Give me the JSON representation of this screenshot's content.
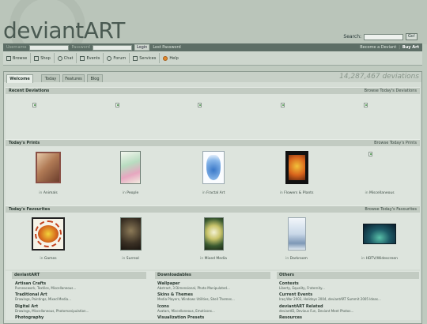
{
  "header": {
    "logo": "deviantART",
    "search_label": "Search:",
    "search_value": "",
    "search_button": "Go!"
  },
  "loginbar": {
    "username_label": "Username",
    "password_label": "Password",
    "login_button": "Login",
    "lost_password": "Lost Password",
    "become_deviant": "Become a Deviant",
    "separator": "|",
    "buy_art": "Buy Art"
  },
  "nav": {
    "items": [
      {
        "label": "Browse",
        "icon": "browse-icon"
      },
      {
        "label": "Shop",
        "icon": "printer-icon"
      },
      {
        "label": "Chat",
        "icon": "chat-icon"
      },
      {
        "label": "Events",
        "icon": "events-icon"
      },
      {
        "label": "Forum",
        "icon": "forum-icon"
      },
      {
        "label": "Services",
        "icon": "services-icon"
      },
      {
        "label": "Help",
        "icon": "help-icon"
      }
    ]
  },
  "tabs": [
    {
      "label": "Welcome",
      "active": true
    },
    {
      "label": "Today",
      "active": false
    },
    {
      "label": "Features",
      "active": false
    },
    {
      "label": "Blog",
      "active": false
    }
  ],
  "deviation_count": "14,287,467 deviations",
  "sections": {
    "recent": {
      "title": "Recent Deviations",
      "link": "Browse Today's Deviations"
    },
    "prints": {
      "title": "Today's Prints",
      "link": "Browse Today's Prints",
      "items": [
        {
          "prefix": "in",
          "category": "Animals"
        },
        {
          "prefix": "in",
          "category": "People"
        },
        {
          "prefix": "in",
          "category": "Fractal Art"
        },
        {
          "prefix": "in",
          "category": "Flowers & Plants"
        },
        {
          "prefix": "in",
          "category": "Miscellaneous"
        }
      ]
    },
    "favourites": {
      "title": "Today's Favourites",
      "link": "Browse Today's Favourites",
      "items": [
        {
          "prefix": "in",
          "category": "Games"
        },
        {
          "prefix": "in",
          "category": "Surreal"
        },
        {
          "prefix": "in",
          "category": "Mixed Media"
        },
        {
          "prefix": "in",
          "category": "Darkroom"
        },
        {
          "prefix": "in",
          "category": "HDTV/Widescreen"
        }
      ]
    }
  },
  "footer": {
    "col1": {
      "title": "deviantART",
      "entries": [
        {
          "name": "Artisan Crafts",
          "sub": "Purseacwork, Textiles, Miscellaneous..."
        },
        {
          "name": "Traditional Art",
          "sub": "Drawings, Paintings, Mixed Media..."
        },
        {
          "name": "Digital Art",
          "sub": "Drawings, Miscellaneous, Photomanipulation..."
        },
        {
          "name": "Photography",
          "sub": ""
        }
      ]
    },
    "col2": {
      "title": "Downloadables",
      "entries": [
        {
          "name": "Wallpaper",
          "sub": "Abstract, 3 Dimensional, Photo Manipulated..."
        },
        {
          "name": "Skins & Themes",
          "sub": "Media Players, Windows Utilities, Shell Themes..."
        },
        {
          "name": "Icons",
          "sub": "Avatars, Miscellaneous, Emoticons..."
        },
        {
          "name": "Visualization Presets",
          "sub": ""
        }
      ]
    },
    "col3": {
      "title": "Others",
      "entries": [
        {
          "name": "Contests",
          "sub": "Liberty, Equality, Fraternity..."
        },
        {
          "name": "Current Events",
          "sub": "Iraq War 2003, Holidays 2004, deviantART Summit 2005 Ideas..."
        },
        {
          "name": "deviantART Related",
          "sub": "deviantID, Devious Fun, Deviant Meet Photos..."
        },
        {
          "name": "Resources",
          "sub": ""
        }
      ]
    }
  },
  "colors": {
    "background": "#bfcabf",
    "login_bar": "#5d6e66",
    "help_icon": "#e08a2e"
  }
}
